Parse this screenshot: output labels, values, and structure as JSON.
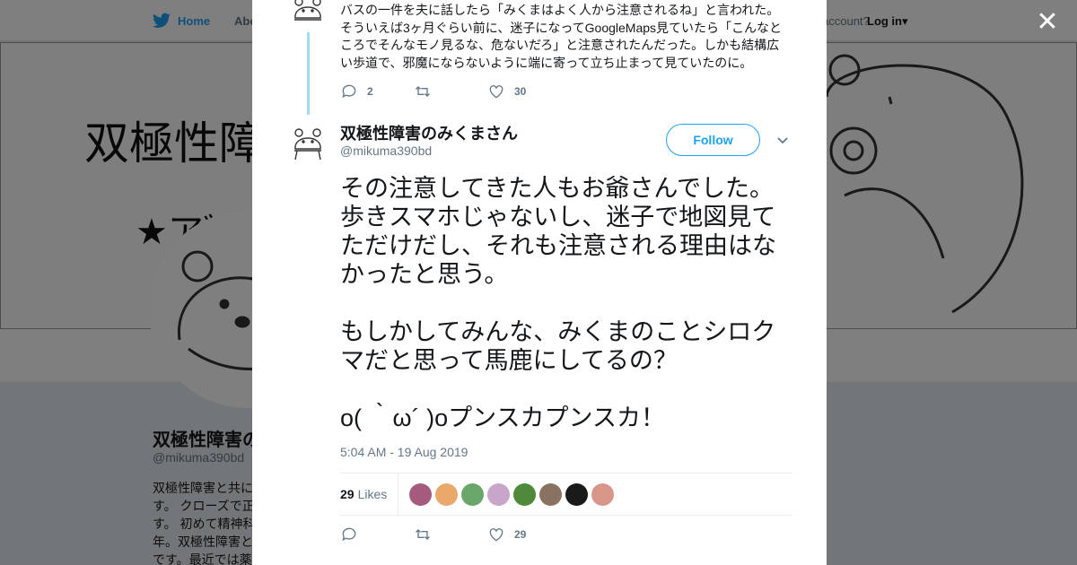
{
  "background": {
    "nav": {
      "home_label": "Home",
      "about_label": "Abo",
      "account_text": "account?",
      "login_label": "Log in"
    },
    "banner": {
      "title": "双極性障",
      "subtitle": "★ア゛"
    },
    "profile": {
      "name": "双極性障害の",
      "handle": "@mikuma390bd",
      "bio": "双極性障害と共にす。 クローズで正す。 初めて精神科年。双極性障害とです。最近では薬"
    }
  },
  "modal": {
    "close_label": "✕",
    "previous_tweet": {
      "text": "バスの一件を夫に話したら「みくまはよく人から注意されるね」と言われた。そういえば3ヶ月ぐらい前に、迷子になってGoogleMaps見ていたら「こんなところでそんなモノ見るな、危ないだろ」と注意されたんだった。しかも結構広い歩道で、邪魔にならないように端に寄って立ち止まって見ていたのに。",
      "reply_count": "2",
      "retweet_count": "",
      "like_count": "30"
    },
    "tweet": {
      "author_name": "双極性障害のみくまさん",
      "author_handle": "@mikuma390bd",
      "follow_label": "Follow",
      "text": "その注意してきた人もお爺さんでした。歩きスマホじゃないし、迷子で地図見てただけだし、それも注意される理由はなかったと思う。\n\nもしかしてみんな、みくまのことシロクマだと思って馬鹿にしてるの？\n\no( ｀ω´ )oプンスカプンスカ！",
      "timestamp": "5:04 AM - 19 Aug 2019",
      "likes_count": "29",
      "likes_label": "Likes",
      "reply_count": "",
      "retweet_count": "",
      "like_count": "29"
    },
    "likers": [
      "#a55b7e",
      "#e8a96b",
      "#6aa56a",
      "#c7a6c9",
      "#4e8a3a",
      "#8a7260",
      "#1a1a1a",
      "#d8968a"
    ]
  },
  "colors": {
    "accent": "#1da1f2",
    "muted": "#657786",
    "thread_line": "#a3d9f9"
  }
}
